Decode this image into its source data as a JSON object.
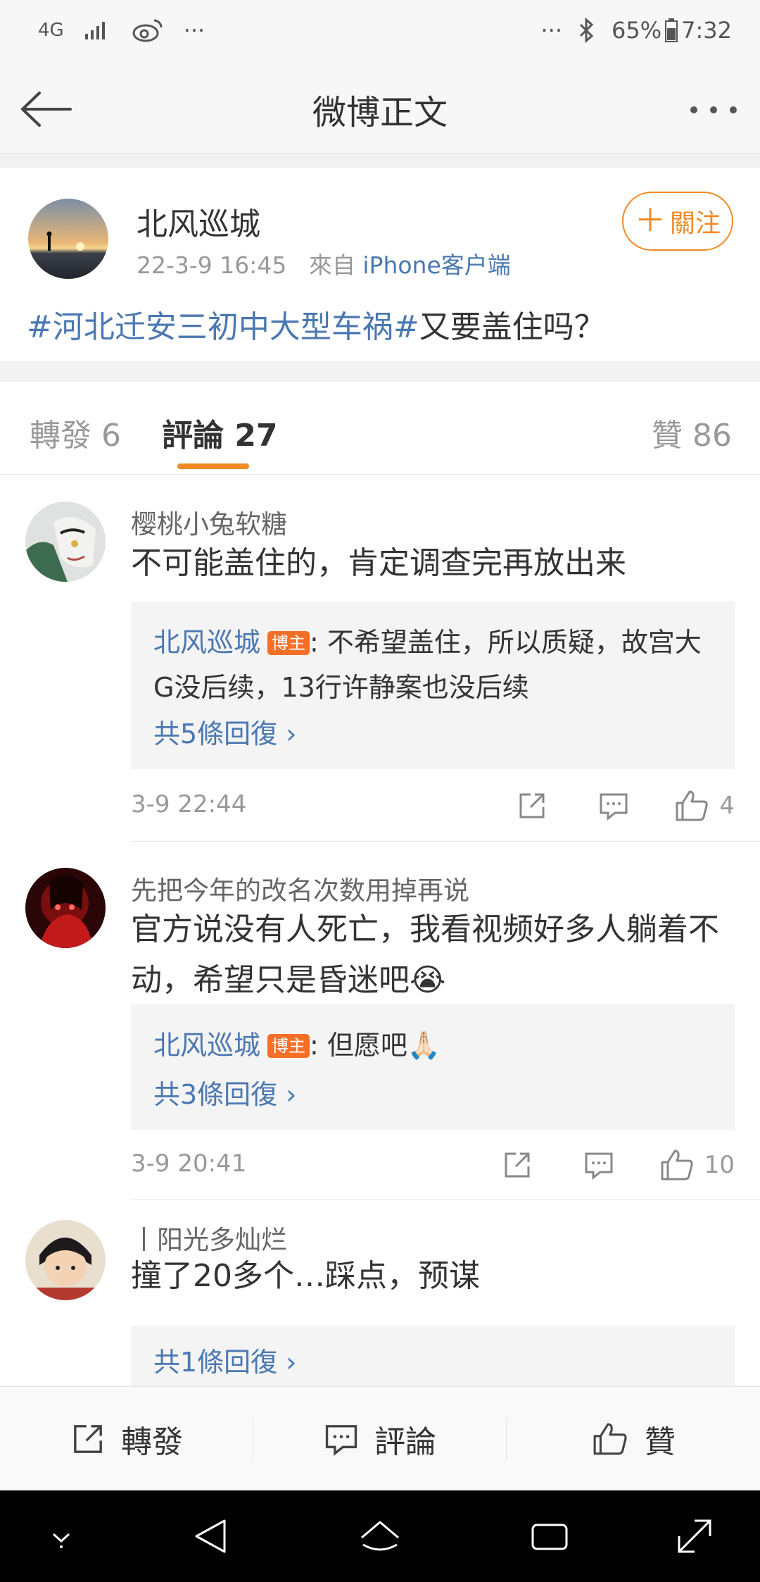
{
  "status_bar": {
    "network": "4G",
    "more": "···",
    "notif_more": "···",
    "battery": "65%",
    "time": "7:32"
  },
  "header": {
    "title": "微博正文"
  },
  "post": {
    "author": "北风巡城",
    "time": "22-3-9 16:45",
    "from_label": "來自",
    "source": "iPhone客户端",
    "follow_label": "關注",
    "hashtag": "#河北迁安三初中大型车祸#",
    "text": "又要盖住吗？"
  },
  "tabs": {
    "repost": "轉發 6",
    "comment": "評論 27",
    "like": "贊 86"
  },
  "comments": [
    {
      "name": "樱桃小兔软糖",
      "text": "不可能盖住的，肯定调查完再放出来",
      "reply_author": "北风巡城",
      "reply_badge": "博主",
      "reply_text": ": 不希望盖住，所以质疑，故宫大G没后续，13行许静案也没后续",
      "reply_more": "共5條回復 ›",
      "time": "3-9 22:44",
      "likes": "4"
    },
    {
      "name": "先把今年的改名次数用掉再说",
      "text": "官方说没有人死亡，我看视频好多人躺着不动，希望只是昏迷吧😭",
      "reply_author": "北风巡城",
      "reply_badge": "博主",
      "reply_text": ": 但愿吧🙏🏻",
      "reply_more": "共3條回復 ›",
      "time": "3-9 20:41",
      "likes": "10"
    },
    {
      "name": "丨阳光多灿烂",
      "text": "撞了20多个…踩点，预谋",
      "reply_more": "共1條回復 ›"
    }
  ],
  "bottom_bar": {
    "repost": "轉發",
    "comment": "評論",
    "like": "贊"
  },
  "colors": {
    "accent_orange": "#f08a24",
    "link_blue": "#4a78b2",
    "badge_orange": "#f56f26"
  }
}
